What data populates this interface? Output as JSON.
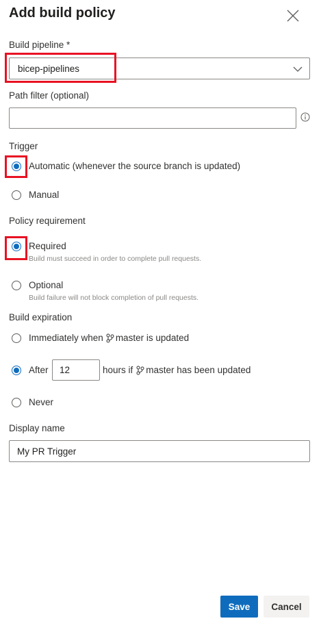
{
  "header": {
    "title": "Add build policy"
  },
  "build_pipeline": {
    "label": "Build pipeline *",
    "value": "bicep-pipelines"
  },
  "path_filter": {
    "label": "Path filter (optional)",
    "value": "",
    "placeholder": ""
  },
  "trigger": {
    "label": "Trigger",
    "options": [
      {
        "label": "Automatic (whenever the source branch is updated)",
        "selected": true
      },
      {
        "label": "Manual",
        "selected": false
      }
    ]
  },
  "policy_requirement": {
    "label": "Policy requirement",
    "options": [
      {
        "label": "Required",
        "description": "Build must succeed in order to complete pull requests.",
        "selected": true
      },
      {
        "label": "Optional",
        "description": "Build failure will not block completion of pull requests.",
        "selected": false
      }
    ]
  },
  "build_expiration": {
    "label": "Build expiration",
    "immediately_prefix": "Immediately when",
    "immediately_suffix": "master is updated",
    "after_prefix": "After",
    "hours_value": "12",
    "after_suffix_prefix": "hours if",
    "after_suffix": "master has been updated",
    "never": "Never",
    "selected": "after"
  },
  "display_name": {
    "label": "Display name",
    "value": "My PR Trigger"
  },
  "footer": {
    "save_label": "Save",
    "cancel_label": "Cancel"
  },
  "colors": {
    "accent": "#0f6cbd",
    "highlight": "#e81123"
  },
  "icons": [
    "close-icon",
    "chevron-down-icon",
    "info-icon",
    "branch-icon"
  ]
}
